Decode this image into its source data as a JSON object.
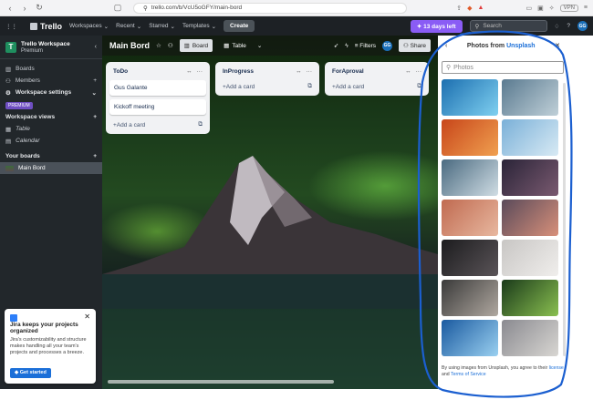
{
  "browser": {
    "url": "trello.com/b/VcU5oGFY/main-bord",
    "vpn_label": "VPN"
  },
  "header": {
    "logo": "Trello",
    "menus": [
      "Workspaces",
      "Recent",
      "Starred",
      "Templates"
    ],
    "create_label": "Create",
    "trial_label": "13 days left",
    "search_placeholder": "Search",
    "avatar_initials": "GG"
  },
  "sidebar": {
    "workspace_name": "Trello Workspace",
    "workspace_plan": "Premium",
    "items": [
      {
        "label": "Boards"
      },
      {
        "label": "Members"
      },
      {
        "label": "Workspace settings"
      }
    ],
    "premium_tag": "PREMIUM",
    "views_heading": "Workspace views",
    "views": [
      {
        "label": "Table"
      },
      {
        "label": "Calendar"
      }
    ],
    "boards_heading": "Your boards",
    "boards": [
      {
        "label": "Main Bord"
      }
    ]
  },
  "promo": {
    "title": "Jira keeps your projects organized",
    "body": "Jira's customizability and structure makes handling all your team's projects and processes a breeze.",
    "button": "Get started"
  },
  "board": {
    "title": "Main Bord",
    "views": [
      "Board",
      "Table"
    ],
    "filters_label": "Filters",
    "avatar_initials": "GG",
    "share_label": "Share",
    "lists": [
      {
        "title": "ToDo",
        "cards": [
          "Gus Galante",
          "Kickoff meeting"
        ],
        "add_label": "Add a card"
      },
      {
        "title": "InProgress",
        "cards": [],
        "add_label": "Add a card"
      },
      {
        "title": "ForAproval",
        "cards": [],
        "add_label": "Add a card"
      }
    ]
  },
  "photo_panel": {
    "title_prefix": "Photos from ",
    "title_link": "Unsplash",
    "search_placeholder": "Photos",
    "photos": [
      {
        "name": "blue-pool",
        "colors": [
          "#1c6fb0",
          "#7fd0f0"
        ]
      },
      {
        "name": "misty-mountain",
        "colors": [
          "#5a7a90",
          "#c0d0d8"
        ]
      },
      {
        "name": "orange-abstract",
        "colors": [
          "#c8461a",
          "#f0a050"
        ]
      },
      {
        "name": "blue-waves",
        "colors": [
          "#7ab0d8",
          "#d8eaf4"
        ]
      },
      {
        "name": "snowy-forest",
        "colors": [
          "#4a6a80",
          "#d0dde4"
        ]
      },
      {
        "name": "starry-tree",
        "colors": [
          "#2a2438",
          "#7a5a70"
        ]
      },
      {
        "name": "sunset-lake",
        "colors": [
          "#c06a50",
          "#e8b8a0"
        ]
      },
      {
        "name": "dusk-mountains",
        "colors": [
          "#5a4a5a",
          "#d8907a"
        ]
      },
      {
        "name": "dark-landscape",
        "colors": [
          "#1c1c1e",
          "#5a5458"
        ]
      },
      {
        "name": "white-ribbon",
        "colors": [
          "#c8c6c4",
          "#f0eeec"
        ]
      },
      {
        "name": "bird-feathers",
        "colors": [
          "#3a3a3a",
          "#b0a8a0"
        ]
      },
      {
        "name": "aurora-hill",
        "colors": [
          "#1a3a1a",
          "#8ac050"
        ]
      },
      {
        "name": "blue-splash",
        "colors": [
          "#1a5aa0",
          "#9ad0f0"
        ]
      },
      {
        "name": "motion-blur",
        "colors": [
          "#8a8a90",
          "#d8d6d2"
        ]
      }
    ],
    "footer_text": "By using images from Unsplash, you agree to their ",
    "footer_link1": "license",
    "footer_and": " and ",
    "footer_link2": "Terms of Service"
  },
  "annotation_color": "#1b5fd0"
}
